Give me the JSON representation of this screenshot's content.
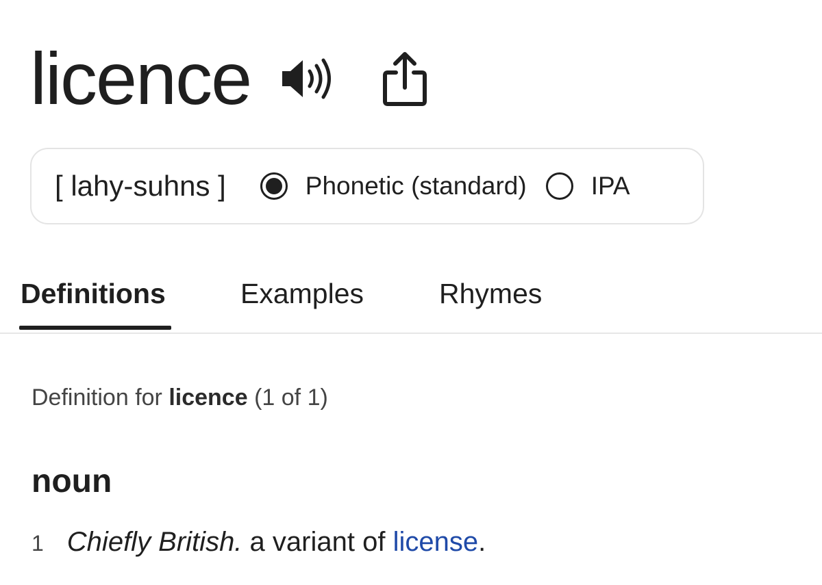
{
  "headword": "licence",
  "icons": {
    "speaker": "speaker-icon",
    "share": "share-icon"
  },
  "pronunciation": {
    "respelling": "[ lahy-suhns ]",
    "options": [
      {
        "label": "Phonetic (standard)",
        "selected": true
      },
      {
        "label": "IPA",
        "selected": false
      }
    ]
  },
  "tabs": [
    {
      "label": "Definitions",
      "active": true
    },
    {
      "label": "Examples",
      "active": false
    },
    {
      "label": "Rhymes",
      "active": false
    }
  ],
  "definition_header": {
    "prefix": "Definition for",
    "word": "licence",
    "count": "(1 of 1)"
  },
  "part_of_speech": "noun",
  "definitions": [
    {
      "number": "1",
      "label": "Chiefly British.",
      "text": "a variant of",
      "link": "license",
      "suffix": "."
    }
  ],
  "colors": {
    "link": "#1f4aa8",
    "text": "#1f1f1f",
    "border": "#e4e4e4"
  }
}
